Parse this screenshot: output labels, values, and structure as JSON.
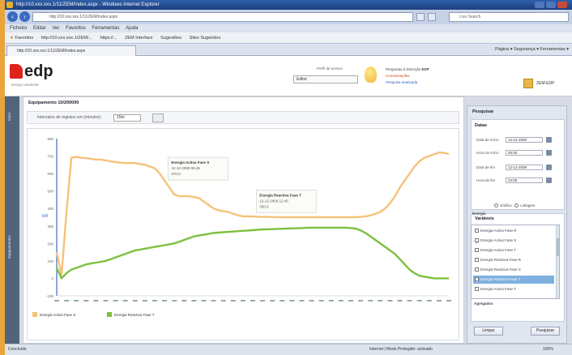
{
  "browser": {
    "title": "http://10.xxx.xxx.1/11/ZEM/Index.aspx - Windows Internet Explorer",
    "address": "http://10.xxx.xxx.1/11/ZEM/Index.aspx",
    "search_placeholder": "Live Search",
    "menu": [
      "Ficheiro",
      "Editar",
      "Ver",
      "Favoritos",
      "Ferramentas",
      "Ajuda"
    ],
    "favorites": [
      "Favoritos",
      "http://10.xxx.xxx.1/ZEM/...",
      "https://...",
      "ZEM Interface",
      "Sugestões",
      "Sites Sugeridos"
    ],
    "tab": "http://10.xxx.xxx.1/11/ZEM/Index.aspx",
    "tab_tools": "Página ▾   Segurança ▾   Ferramentas ▾",
    "status_left": "Concluído",
    "status_zone": "Internet | Modo Protegido: activado",
    "zoom": "100%"
  },
  "app": {
    "logo": "edp",
    "logo_sub": "serviço universal",
    "perfil_label": "Perfil de acesso",
    "perfil_value": "Editor",
    "notifications": [
      "Perguntas à Direcção",
      "Comunicações",
      "Pesquisa avançada"
    ],
    "notif_value": "EDP",
    "user": "ZEM-EDP",
    "left_tabs": [
      "Início",
      "Equipamentos"
    ]
  },
  "main": {
    "title": "Equipamento 10/200000",
    "step_label": "Intervalos de registos em (minutos):",
    "step_value": "15m"
  },
  "right": {
    "title": "Pesquisar",
    "datas_title": "Datas",
    "fields": [
      {
        "label": "Data de início",
        "value": "12-12-2009"
      },
      {
        "label": "Hora de início",
        "value": "00:00"
      },
      {
        "label": "Data de fim",
        "value": "12-12-2009"
      },
      {
        "label": "Hora de fim",
        "value": "23:59"
      }
    ],
    "radio1": "Gráfico",
    "radio2": "Listagem",
    "vars_title": "Variáveis",
    "vars_group": "Energia",
    "vars": [
      {
        "label": "Energia Activa Fase R",
        "checked": false,
        "selected": false
      },
      {
        "label": "Energia Activa Fase S",
        "checked": true,
        "selected": false
      },
      {
        "label": "Energia Activa Fase T",
        "checked": false,
        "selected": false
      },
      {
        "label": "Energia Reactiva Fase R",
        "checked": false,
        "selected": false
      },
      {
        "label": "Energia Reactiva Fase S",
        "checked": false,
        "selected": false
      },
      {
        "label": "Energia Reactiva Fase T",
        "checked": true,
        "selected": true
      },
      {
        "label": "Energia Activa Fase T",
        "checked": false,
        "selected": false
      }
    ],
    "vars_group2": "Agregados",
    "btn_clear": "Limpar",
    "btn_search": "Pesquisar"
  },
  "chart_data": {
    "type": "line",
    "ylim": [
      -100,
      800
    ],
    "yticks": [
      -100,
      0,
      100,
      200,
      300,
      400,
      500,
      600,
      700,
      800
    ],
    "ylabel": "kW",
    "series": [
      {
        "name": "Energia Activa Fase S",
        "color": "#f5c27a",
        "x": [
          0,
          1,
          2,
          3,
          4,
          5,
          6,
          7,
          8,
          9,
          10,
          11,
          12,
          13,
          14,
          15,
          16,
          17,
          18,
          19,
          20,
          21,
          22,
          23,
          24,
          25,
          26,
          27,
          28,
          29,
          30,
          31,
          32,
          33,
          34,
          35,
          36,
          37,
          38,
          39,
          40,
          41,
          42,
          43,
          44,
          45,
          46,
          47,
          48,
          49,
          50,
          51,
          52,
          53,
          54,
          55,
          56,
          57,
          58,
          59,
          60,
          61,
          62,
          63,
          64,
          65,
          66,
          67,
          68,
          69,
          70,
          71,
          72,
          73,
          74,
          75,
          76,
          77,
          78,
          79,
          80
        ],
        "y": [
          150,
          20,
          380,
          690,
          695,
          690,
          688,
          685,
          680,
          680,
          675,
          670,
          665,
          662,
          660,
          660,
          660,
          655,
          650,
          640,
          630,
          600,
          560,
          520,
          480,
          470,
          470,
          470,
          465,
          460,
          440,
          420,
          400,
          390,
          385,
          380,
          370,
          360,
          355,
          355,
          354,
          353,
          352,
          352,
          351,
          351,
          350,
          350,
          350,
          350,
          350,
          350,
          350,
          350,
          350,
          350,
          350,
          350,
          350,
          350,
          350,
          350,
          352,
          355,
          360,
          370,
          380,
          400,
          430,
          470,
          520,
          560,
          600,
          640,
          670,
          690,
          700,
          710,
          720,
          718,
          712
        ]
      },
      {
        "name": "Energia Reactiva Fase T",
        "color": "#7cc040",
        "x": [
          0,
          1,
          2,
          3,
          4,
          5,
          6,
          7,
          8,
          9,
          10,
          11,
          12,
          13,
          14,
          15,
          16,
          17,
          18,
          19,
          20,
          21,
          22,
          23,
          24,
          25,
          26,
          27,
          28,
          29,
          30,
          31,
          32,
          33,
          34,
          35,
          36,
          37,
          38,
          39,
          40,
          41,
          42,
          43,
          44,
          45,
          46,
          47,
          48,
          49,
          50,
          51,
          52,
          53,
          54,
          55,
          56,
          57,
          58,
          59,
          60,
          61,
          62,
          63,
          64,
          65,
          66,
          67,
          68,
          69,
          70,
          71,
          72,
          73,
          74,
          75,
          76,
          77,
          78,
          79,
          80
        ],
        "y": [
          60,
          0,
          30,
          50,
          60,
          70,
          80,
          85,
          90,
          95,
          100,
          110,
          120,
          130,
          140,
          150,
          160,
          165,
          170,
          175,
          180,
          185,
          190,
          195,
          200,
          210,
          220,
          230,
          240,
          245,
          250,
          255,
          260,
          262,
          264,
          266,
          268,
          270,
          272,
          274,
          276,
          278,
          280,
          281,
          282,
          283,
          284,
          285,
          286,
          287,
          288,
          289,
          290,
          290,
          290,
          290,
          290,
          290,
          290,
          290,
          288,
          285,
          275,
          260,
          240,
          220,
          200,
          180,
          160,
          140,
          110,
          80,
          50,
          30,
          15,
          10,
          5,
          0,
          0,
          0,
          0
        ]
      }
    ],
    "tooltips": [
      {
        "series": "Energia Activa Fase S",
        "time": "12-12-2009 06:45",
        "value": "470,0",
        "x": 27
      },
      {
        "series": "Energia Reactiva Fase T",
        "time": "12-12-2009 12:45",
        "value": "350,0",
        "x": 45
      }
    ],
    "legend": [
      "Energia Activa Fase S",
      "Energia Reactiva Fase T"
    ],
    "legend_position": "bottom-left"
  }
}
